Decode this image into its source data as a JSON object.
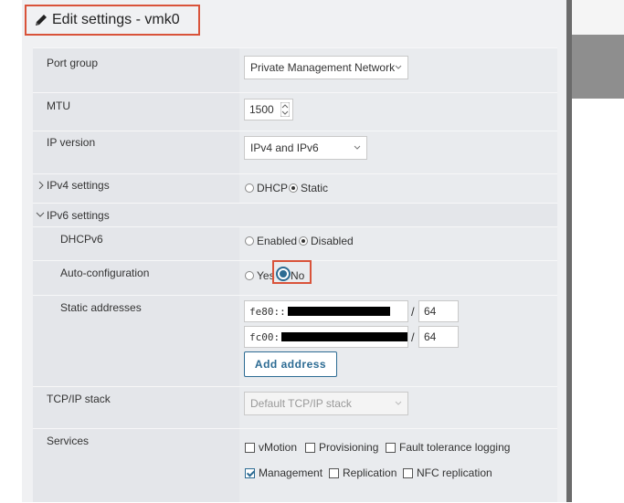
{
  "title": "Edit settings - vmk0",
  "rows": {
    "port_group": {
      "label": "Port group",
      "value": "Private Management Network"
    },
    "mtu": {
      "label": "MTU",
      "value": "1500"
    },
    "ip_version": {
      "label": "IP version",
      "value": "IPv4 and IPv6"
    },
    "ipv4": {
      "label": "IPv4 settings",
      "options": [
        "DHCP",
        "Static"
      ],
      "selected": "Static"
    },
    "ipv6": {
      "label": "IPv6 settings"
    },
    "dhcpv6": {
      "label": "DHCPv6",
      "options": [
        "Enabled",
        "Disabled"
      ],
      "selected": "Disabled"
    },
    "autoconf": {
      "label": "Auto-configuration",
      "options": [
        "Yes",
        "No"
      ],
      "selected": "No"
    },
    "static_addresses": {
      "label": "Static addresses",
      "addresses": [
        {
          "prefix_text": "fe80::",
          "length": "64"
        },
        {
          "prefix_text": "fc00:",
          "length": "64"
        }
      ],
      "separator": "/",
      "add_label": "Add address"
    },
    "tcpip": {
      "label": "TCP/IP stack",
      "value": "Default TCP/IP stack"
    },
    "services": {
      "label": "Services",
      "items": [
        {
          "label": "vMotion",
          "checked": false
        },
        {
          "label": "Provisioning",
          "checked": false
        },
        {
          "label": "Fault tolerance logging",
          "checked": false
        },
        {
          "label": "Management",
          "checked": true
        },
        {
          "label": "Replication",
          "checked": false
        },
        {
          "label": "NFC replication",
          "checked": false
        }
      ]
    }
  },
  "colors": {
    "accent": "#2c6b93",
    "highlight": "#d9533a"
  },
  "icons": {
    "title": "pencil-icon",
    "dropdown": "chevron-down-icon",
    "expand": "chevron-right-icon",
    "collapse": "chevron-down-icon"
  }
}
